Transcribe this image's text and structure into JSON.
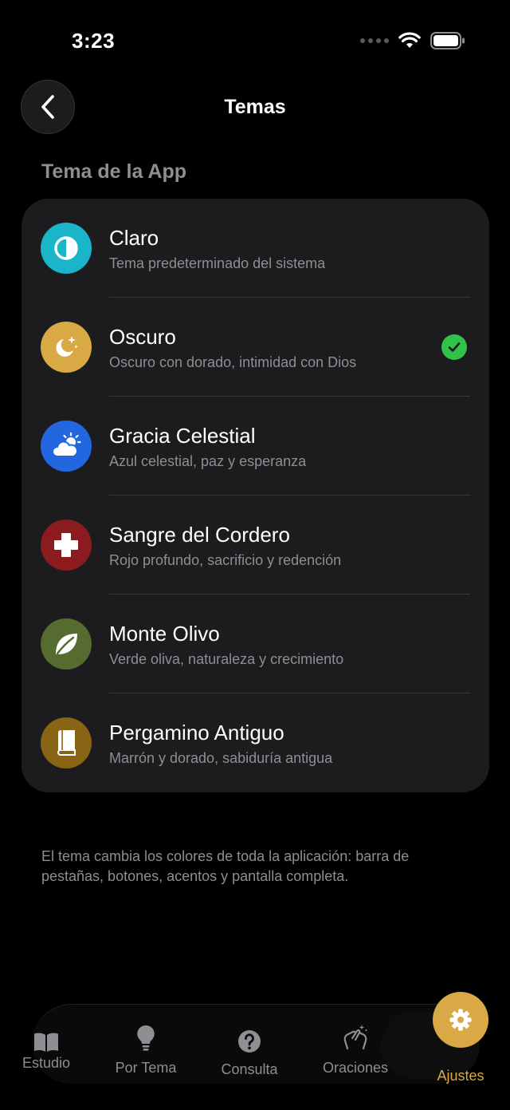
{
  "status": {
    "time": "3:23"
  },
  "header": {
    "title": "Temas"
  },
  "section": {
    "title": "Tema de la App"
  },
  "themes": [
    {
      "name": "Claro",
      "description": "Tema predeterminado del sistema",
      "color": "#1ab5c9",
      "icon": "half-circle-icon",
      "selected": false
    },
    {
      "name": "Oscuro",
      "description": "Oscuro con dorado, intimidad con Dios",
      "color": "#d8a945",
      "icon": "moon-stars-icon",
      "selected": true
    },
    {
      "name": "Gracia Celestial",
      "description": "Azul celestial, paz y esperanza",
      "color": "#2267e0",
      "icon": "cloud-sun-icon",
      "selected": false
    },
    {
      "name": "Sangre del Cordero",
      "description": "Rojo profundo, sacrificio y redención",
      "color": "#8b1b1f",
      "icon": "cross-icon",
      "selected": false
    },
    {
      "name": "Monte Olivo",
      "description": "Verde oliva, naturaleza y crecimiento",
      "color": "#566b2f",
      "icon": "leaf-icon",
      "selected": false
    },
    {
      "name": "Pergamino Antiguo",
      "description": "Marrón y dorado, sabiduría antigua",
      "color": "#8a6415",
      "icon": "book-icon",
      "selected": false
    }
  ],
  "footer": {
    "note": "El tema cambia los colores de toda la aplicación: barra de pestañas, botones, acentos y pantalla completa."
  },
  "tabs": {
    "estudio": "Estudio",
    "por_tema": "Por Tema",
    "consulta": "Consulta",
    "oraciones": "Oraciones",
    "ajustes": "Ajustes"
  },
  "colors": {
    "accent": "#d8a945",
    "check": "#30c24b",
    "background": "#000000",
    "card": "#1c1c1e"
  }
}
